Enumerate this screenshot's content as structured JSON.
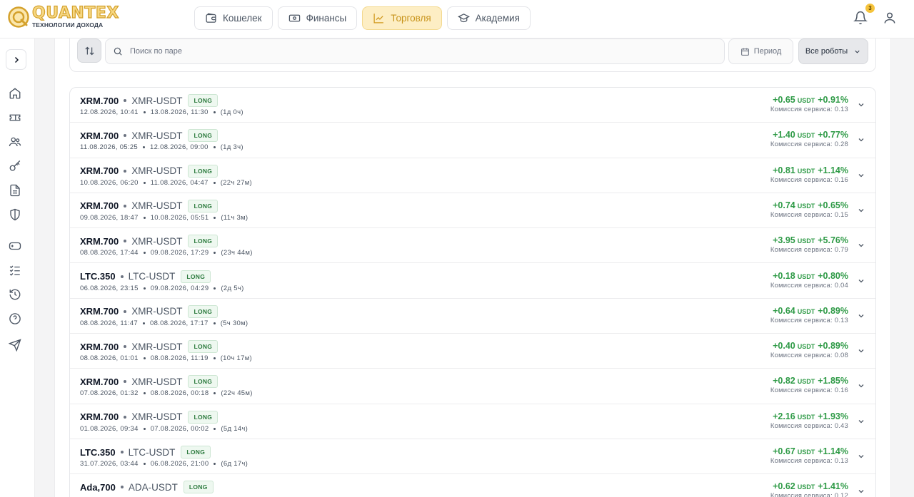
{
  "brand": {
    "name": "QUANTEX",
    "tagline": "ТЕХНОЛОГИИ ДОХОДА"
  },
  "nav": [
    {
      "label": "Кошелек",
      "icon": "wallet-icon",
      "active": false
    },
    {
      "label": "Финансы",
      "icon": "banknote-icon",
      "active": false
    },
    {
      "label": "Торговля",
      "icon": "chart-line-icon",
      "active": true
    },
    {
      "label": "Академия",
      "icon": "graduation-cap-icon",
      "active": false
    }
  ],
  "notifications": {
    "count": "3"
  },
  "sidebar": {
    "icons": [
      "home-icon",
      "ticket-icon",
      "users-icon",
      "key-icon",
      "document-icon",
      "shield-icon",
      "gamepad-icon",
      "checklist-icon",
      "history-icon",
      "help-icon",
      "send-icon"
    ]
  },
  "filters": {
    "search_placeholder": "Поиск по паре",
    "period_label": "Период",
    "robots_label": "Все роботы"
  },
  "colors": {
    "accent": "#f5c33b",
    "positive": "#2e9a46",
    "long_badge": "#2b7a3d"
  },
  "fee_label": "Комиссия сервиса:",
  "trades": [
    {
      "bot": "XRM.700",
      "pair": "XMR-USDT",
      "side": "LONG",
      "open": "12.08.2026, 10:41",
      "close": "13.08.2026, 11:30",
      "duration": "(1д 0ч)",
      "pnl": "+0.65",
      "unit": "USDT",
      "pct": "+0.91%",
      "fee": "0.13"
    },
    {
      "bot": "XRM.700",
      "pair": "XMR-USDT",
      "side": "LONG",
      "open": "11.08.2026, 05:25",
      "close": "12.08.2026, 09:00",
      "duration": "(1д 3ч)",
      "pnl": "+1.40",
      "unit": "USDT",
      "pct": "+0.77%",
      "fee": "0.28"
    },
    {
      "bot": "XRM.700",
      "pair": "XMR-USDT",
      "side": "LONG",
      "open": "10.08.2026, 06:20",
      "close": "11.08.2026, 04:47",
      "duration": "(22ч 27м)",
      "pnl": "+0.81",
      "unit": "USDT",
      "pct": "+1.14%",
      "fee": "0.16"
    },
    {
      "bot": "XRM.700",
      "pair": "XMR-USDT",
      "side": "LONG",
      "open": "09.08.2026, 18:47",
      "close": "10.08.2026, 05:51",
      "duration": "(11ч 3м)",
      "pnl": "+0.74",
      "unit": "USDT",
      "pct": "+0.65%",
      "fee": "0.15"
    },
    {
      "bot": "XRM.700",
      "pair": "XMR-USDT",
      "side": "LONG",
      "open": "08.08.2026, 17:44",
      "close": "09.08.2026, 17:29",
      "duration": "(23ч 44м)",
      "pnl": "+3.95",
      "unit": "USDT",
      "pct": "+5.76%",
      "fee": "0.79"
    },
    {
      "bot": "LTC.350",
      "pair": "LTC-USDT",
      "side": "LONG",
      "open": "06.08.2026, 23:15",
      "close": "09.08.2026, 04:29",
      "duration": "(2д 5ч)",
      "pnl": "+0.18",
      "unit": "USDT",
      "pct": "+0.80%",
      "fee": "0.04"
    },
    {
      "bot": "XRM.700",
      "pair": "XMR-USDT",
      "side": "LONG",
      "open": "08.08.2026, 11:47",
      "close": "08.08.2026, 17:17",
      "duration": "(5ч 30м)",
      "pnl": "+0.64",
      "unit": "USDT",
      "pct": "+0.89%",
      "fee": "0.13"
    },
    {
      "bot": "XRM.700",
      "pair": "XMR-USDT",
      "side": "LONG",
      "open": "08.08.2026, 01:01",
      "close": "08.08.2026, 11:19",
      "duration": "(10ч 17м)",
      "pnl": "+0.40",
      "unit": "USDT",
      "pct": "+0.89%",
      "fee": "0.08"
    },
    {
      "bot": "XRM.700",
      "pair": "XMR-USDT",
      "side": "LONG",
      "open": "07.08.2026, 01:32",
      "close": "08.08.2026, 00:18",
      "duration": "(22ч 45м)",
      "pnl": "+0.82",
      "unit": "USDT",
      "pct": "+1.85%",
      "fee": "0.16"
    },
    {
      "bot": "XRM.700",
      "pair": "XMR-USDT",
      "side": "LONG",
      "open": "01.08.2026, 09:34",
      "close": "07.08.2026, 00:02",
      "duration": "(5д 14ч)",
      "pnl": "+2.16",
      "unit": "USDT",
      "pct": "+1.93%",
      "fee": "0.43"
    },
    {
      "bot": "LTC.350",
      "pair": "LTC-USDT",
      "side": "LONG",
      "open": "31.07.2026, 03:44",
      "close": "06.08.2026, 21:00",
      "duration": "(6д 17ч)",
      "pnl": "+0.67",
      "unit": "USDT",
      "pct": "+1.14%",
      "fee": "0.13"
    },
    {
      "bot": "Ada,700",
      "pair": "ADA-USDT",
      "side": "LONG",
      "open": "",
      "close": "",
      "duration": "",
      "pnl": "+0.62",
      "unit": "USDT",
      "pct": "+1.41%",
      "fee": "0.12"
    }
  ]
}
